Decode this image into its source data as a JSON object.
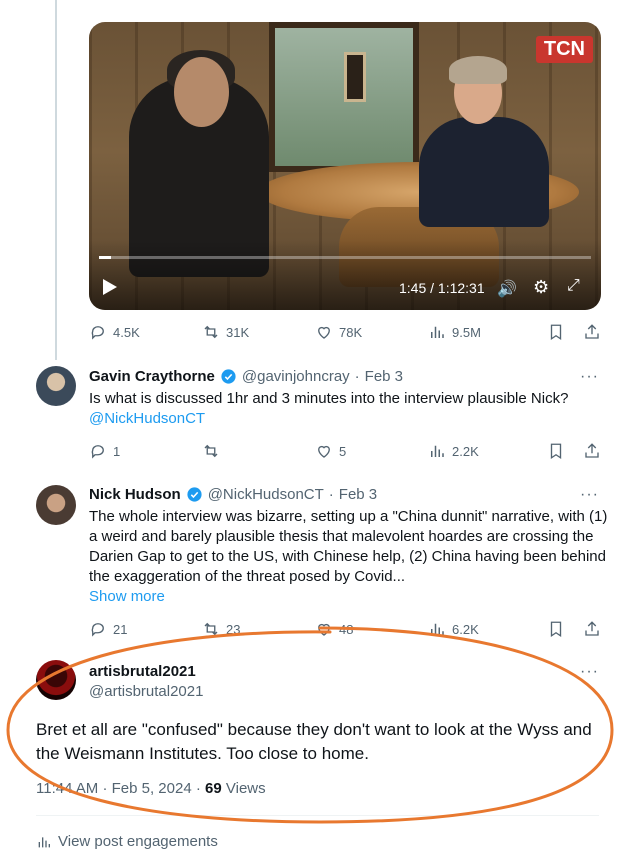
{
  "video": {
    "time": "1:45 / 1:12:31",
    "progress_fraction": 0.024,
    "channel_logo": "TCN"
  },
  "video_actions": {
    "replies": "4.5K",
    "reposts": "31K",
    "likes": "78K",
    "views": "9.5M"
  },
  "reply1": {
    "name": "Gavin Craythorne",
    "handle": "@gavinjohncray",
    "dot": "·",
    "date": "Feb 3",
    "text": "Is what is discussed 1hr and 3 minutes into the interview plausible Nick?",
    "mention": "@NickHudsonCT",
    "more": "···",
    "actions": {
      "replies": "1",
      "reposts": "",
      "likes": "5",
      "views": "2.2K"
    }
  },
  "reply2": {
    "name": "Nick Hudson",
    "handle": "@NickHudsonCT",
    "dot": "·",
    "date": "Feb 3",
    "text": "The whole interview was bizarre, setting up a \"China dunnit\" narrative, with (1) a weird and barely plausible thesis that malevolent hoardes are crossing the Darien Gap to get to the US, with Chinese help, (2) China having been behind the exaggeration of the threat posed by Covid...",
    "show_more": "Show more",
    "more": "···",
    "actions": {
      "replies": "21",
      "reposts": "23",
      "likes": "48",
      "views": "6.2K"
    }
  },
  "main_post": {
    "name": "artisbrutal2021",
    "handle": "@artisbrutal2021",
    "more": "···",
    "text": "Bret et all are \"confused\" because they don't want to look at the Wyss and the Weismann Institutes.  Too close to home.",
    "time": "11:44 AM",
    "date": "Feb 5, 2024",
    "views_count": "69",
    "views_label": "Views",
    "dot": "·"
  },
  "engagements_label": "View post engagements",
  "colors": {
    "accent": "#1d9bf0",
    "secondary_text": "#536471",
    "annotation": "#e8782f"
  }
}
